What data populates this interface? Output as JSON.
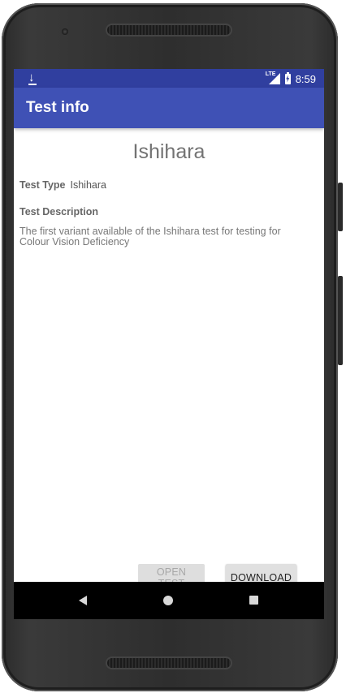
{
  "status_bar": {
    "time": "8:59",
    "network": "LTE",
    "icons": [
      "download-icon",
      "lte-signal-icon",
      "battery-charging-icon"
    ]
  },
  "app_bar": {
    "title": "Test info"
  },
  "test": {
    "name": "Ishihara",
    "type_label": "Test Type",
    "type_value": "Ishihara",
    "description_label": "Test Description",
    "description": "The first variant available of the Ishihara test for testing for Colour Vision Deficiency"
  },
  "buttons": {
    "open_test": "OPEN TEST",
    "download": "DOWNLOAD"
  },
  "nav_bar": {
    "icons": [
      "back-icon",
      "home-icon",
      "recents-icon"
    ]
  },
  "colors": {
    "primary": "#3f51b5",
    "primary_dark": "#303f9f",
    "button": "#e0e0e0",
    "button_disabled_text": "#a8a8a8"
  }
}
